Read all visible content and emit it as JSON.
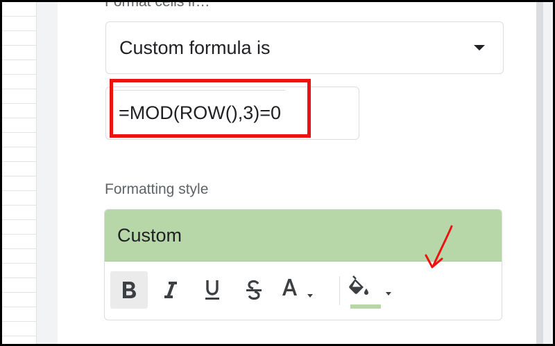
{
  "panel": {
    "section_label": "Format cells if…",
    "condition": {
      "selected": "Custom formula is"
    },
    "formula": {
      "value": "=MOD(ROW(),3)=0"
    },
    "formatting_style": {
      "label": "Formatting style",
      "preview_text": "Custom",
      "preview_color": "#b7d7a8",
      "toolbar": {
        "bold_icon": "format-bold-icon",
        "italic_icon": "format-italic-icon",
        "underline_icon": "format-underline-icon",
        "strikethrough_icon": "format-strikethrough-icon",
        "text_color_icon": "text-color-icon",
        "fill_color_icon": "fill-color-icon",
        "fill_color": "#b7d7a8"
      }
    }
  },
  "annotations": {
    "highlight_color": "#ee1111",
    "arrow_color": "#ee1111"
  }
}
